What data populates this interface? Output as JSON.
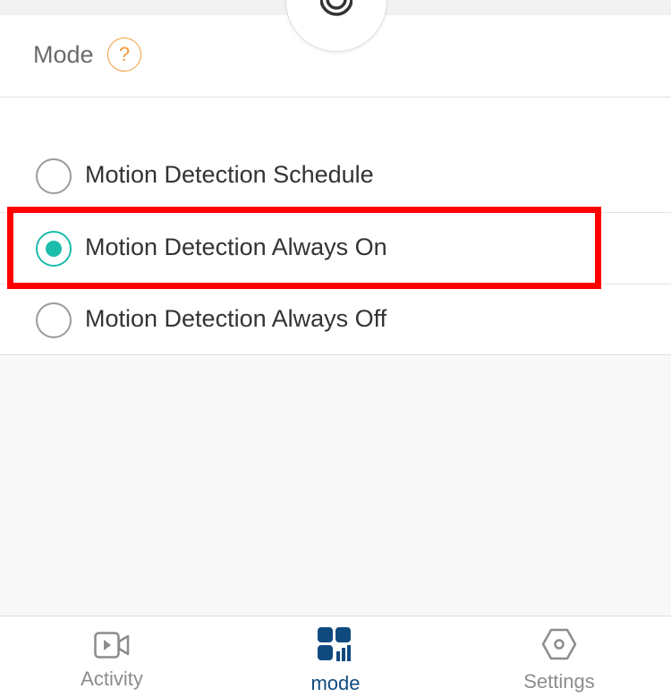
{
  "header": {
    "title": "Mode",
    "help_icon_glyph": "?"
  },
  "colors": {
    "accent": "#1bbcaa",
    "help": "#f29a38",
    "highlight": "#ff0000",
    "active_tab": "#0f4a7f"
  },
  "options": [
    {
      "label": "Motion Detection Schedule",
      "selected": false
    },
    {
      "label": "Motion Detection Always On",
      "selected": true
    },
    {
      "label": "Motion Detection Always Off",
      "selected": false
    }
  ],
  "tabbar": {
    "items": [
      {
        "label": "Activity",
        "icon": "video-camera-icon",
        "active": false
      },
      {
        "label": "mode",
        "icon": "mode-grid-icon",
        "active": true
      },
      {
        "label": "Settings",
        "icon": "hexagon-gear-icon",
        "active": false
      }
    ]
  }
}
